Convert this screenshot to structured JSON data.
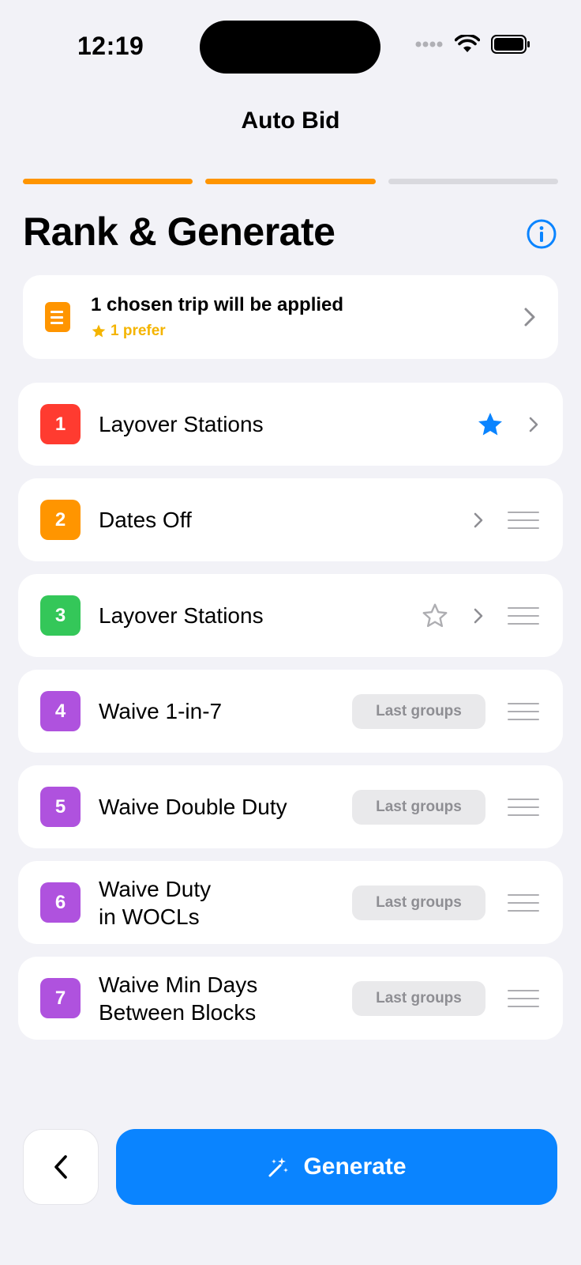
{
  "status": {
    "time": "12:19"
  },
  "nav": {
    "title": "Auto Bid"
  },
  "progress": {
    "total_steps": 3,
    "completed_steps": 2
  },
  "page": {
    "heading": "Rank & Generate"
  },
  "summary": {
    "title": "1 chosen trip will be applied",
    "subtitle": "1 prefer"
  },
  "ranks": [
    {
      "number": "1",
      "label": "Layover Stations",
      "color": "#ff3b30",
      "starred": true
    },
    {
      "number": "2",
      "label": "Dates Off",
      "color": "#ff9500"
    },
    {
      "number": "3",
      "label": "Layover Stations",
      "color": "#34c759",
      "starred": false
    },
    {
      "number": "4",
      "label": "Waive 1-in-7",
      "color": "#af52de",
      "pill": "Last groups"
    },
    {
      "number": "5",
      "label": "Waive Double Duty",
      "color": "#af52de",
      "pill": "Last groups"
    },
    {
      "number": "6",
      "label_line1": "Waive Duty",
      "label_line2": "in WOCLs",
      "color": "#af52de",
      "pill": "Last groups"
    },
    {
      "number": "7",
      "label_line1": "Waive Min Days",
      "label_line2": "Between Blocks",
      "color": "#af52de",
      "pill": "Last groups"
    }
  ],
  "footer": {
    "generate_label": "Generate"
  },
  "colors": {
    "accent": "#0a84ff",
    "progress": "#ff9500",
    "prefer": "#f4b400"
  }
}
